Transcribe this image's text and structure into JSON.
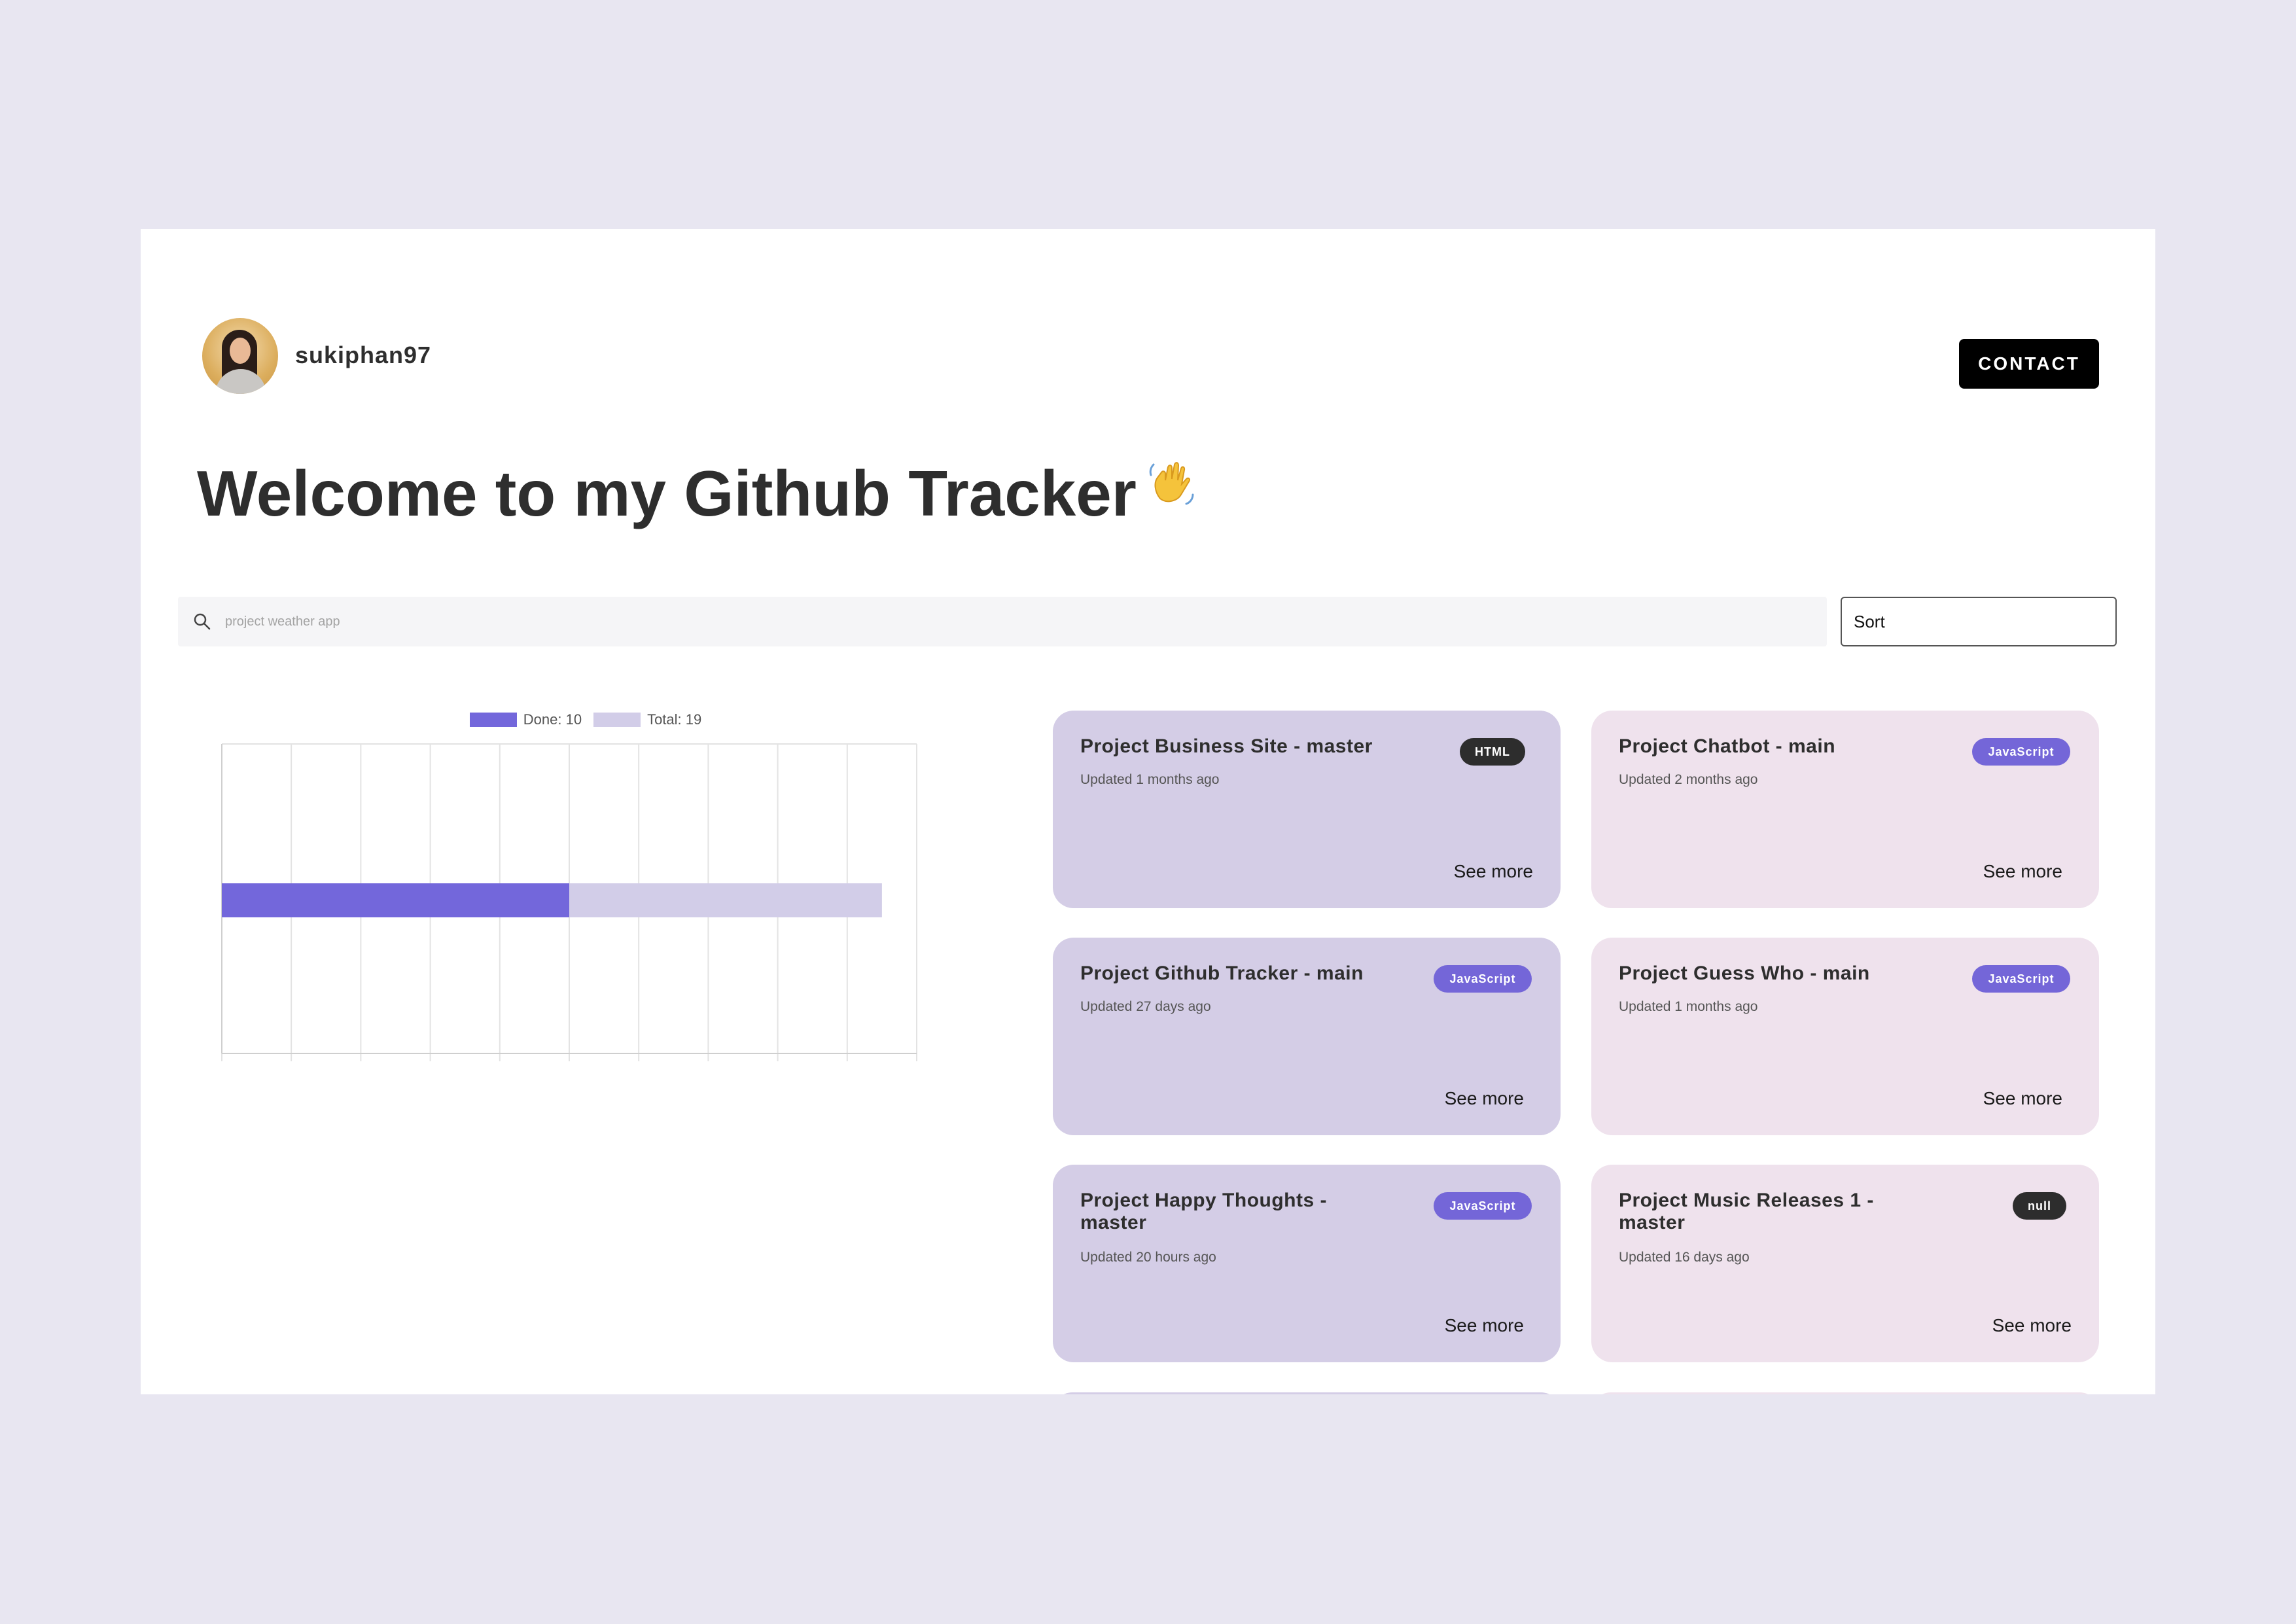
{
  "header": {
    "username": "sukiphan97",
    "contact_label": "CONTACT"
  },
  "title": "Welcome to my Github Tracker",
  "search": {
    "placeholder": "project weather app"
  },
  "sort": {
    "label": "Sort"
  },
  "chart_data": {
    "type": "bar",
    "orientation": "horizontal",
    "stacked": false,
    "series": [
      {
        "name": "Done: 10",
        "value": 10,
        "color": "#7367db"
      },
      {
        "name": "Total: 19",
        "value": 19,
        "color": "#d2cde8"
      }
    ],
    "xlim": [
      0,
      20
    ],
    "xticks": [
      "0",
      "2",
      "4",
      "6",
      "8",
      "10",
      "12",
      "14",
      "16",
      "18",
      "20"
    ],
    "grid": true,
    "legend_position": "top"
  },
  "colors": {
    "accent": "#7367db",
    "card_purple": "#d4cde6",
    "card_pink": "#efe2ed",
    "background": "#e8e6f1"
  },
  "projects": [
    {
      "title": "Project Business Site - master",
      "updated": "Updated 1 months ago",
      "language": "HTML",
      "see_more": "See more"
    },
    {
      "title": "Project Chatbot - main",
      "updated": "Updated 2 months ago",
      "language": "JavaScript",
      "see_more": "See more"
    },
    {
      "title": "Project Github Tracker - main",
      "updated": "Updated 27 days ago",
      "language": "JavaScript",
      "see_more": "See more"
    },
    {
      "title": "Project Guess Who - main",
      "updated": "Updated 1 months ago",
      "language": "JavaScript",
      "see_more": "See more"
    },
    {
      "title": "Project Happy Thoughts - master",
      "updated": "Updated 20 hours ago",
      "language": "JavaScript",
      "see_more": "See more"
    },
    {
      "title": "Project Music Releases 1 - master",
      "updated": "Updated 16 days ago",
      "language": "null",
      "see_more": "See more"
    }
  ]
}
